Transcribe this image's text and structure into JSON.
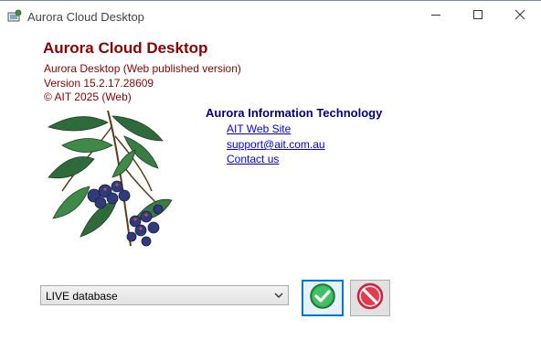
{
  "window": {
    "title": "Aurora Cloud Desktop",
    "controls": {
      "minimize_icon": "minimize-icon",
      "maximize_icon": "maximize-icon",
      "close_icon": "close-icon"
    }
  },
  "about": {
    "product_name": "Aurora Cloud Desktop",
    "edition": "Aurora Desktop (Web published version)",
    "version": "Version 15.2.17.28609",
    "copyright": "© AIT 2025 (Web)",
    "company": "Aurora Information Technology",
    "links": [
      "AIT Web Site",
      "support@ait.com.au",
      "Contact us"
    ]
  },
  "database": {
    "selected": "LIVE database"
  },
  "buttons": {
    "ok_icon": "green-check-icon",
    "cancel_icon": "red-no-entry-icon"
  },
  "colors": {
    "heading": "#8b0000",
    "company": "#000080",
    "link": "#0000ee",
    "focus_border": "#0078d7"
  }
}
